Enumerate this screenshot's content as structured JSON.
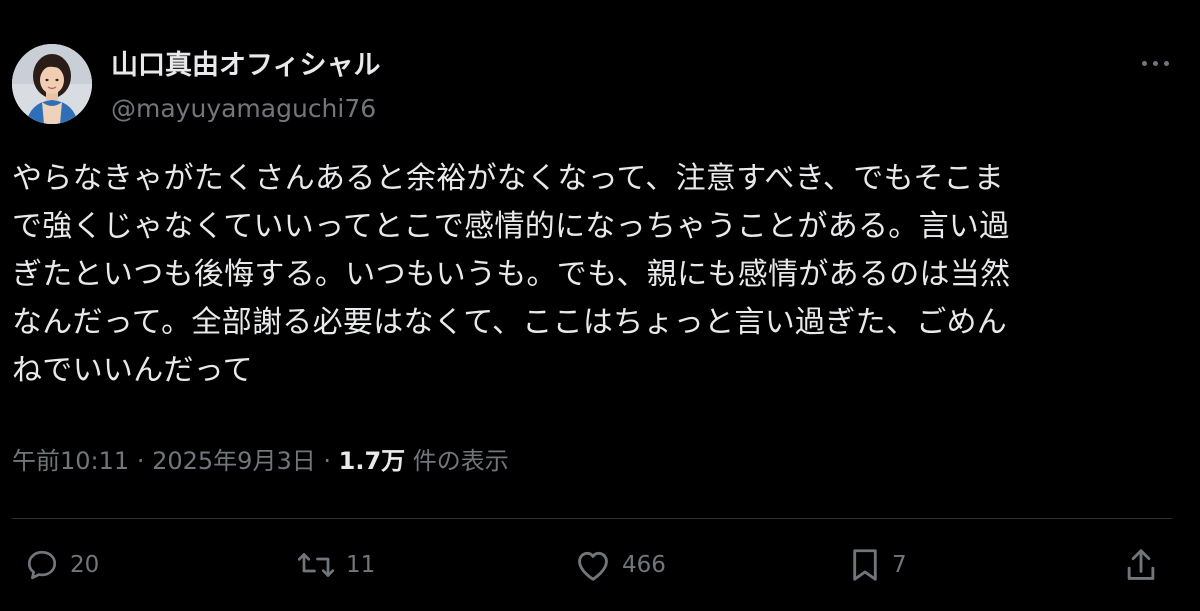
{
  "author": {
    "display_name": "山口真由オフィシャル",
    "handle": "@mayuyamaguchi76"
  },
  "tweet": {
    "text_lines": [
      "やらなきゃがたくさんあると余裕がなくなって、注意すべき、でもそこま",
      "で強くじゃなくていいってとこで感情的になっちゃうことがある。言い過",
      "ぎたといつも後悔する。いつもいうも。でも、親にも感情があるのは当然",
      "なんだって。全部謝る必要はなくて、ここはちょっと言い過ぎた、ごめん",
      "ねでいいんだって"
    ]
  },
  "meta": {
    "time": "午前10:11",
    "separator": "·",
    "date": "2025年9月3日",
    "views_count": "1.7万",
    "views_label": "件の表示"
  },
  "actions": {
    "reply_count": "20",
    "retweet_count": "11",
    "like_count": "466",
    "bookmark_count": "7"
  },
  "icons": {
    "more": "more-horizontal-icon",
    "reply": "reply-icon",
    "retweet": "retweet-icon",
    "like": "heart-icon",
    "bookmark": "bookmark-icon",
    "share": "share-icon"
  },
  "colors": {
    "background": "#000000",
    "primary_text": "#e7e9ea",
    "secondary_text": "#71767b",
    "divider": "#2f3336"
  }
}
